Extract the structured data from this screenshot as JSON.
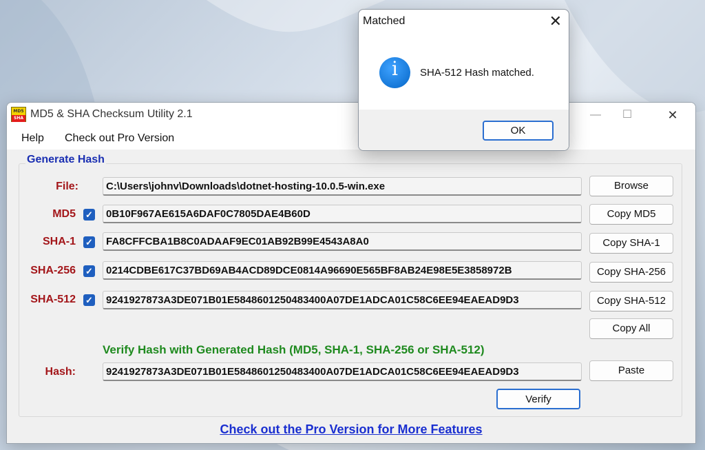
{
  "main_window": {
    "title": "MD5 & SHA Checksum Utility 2.1",
    "icon_text_top": "MD5",
    "icon_text_bottom": "SHA",
    "controls": {
      "minimize": "—",
      "maximize": "☐",
      "close": "✕"
    }
  },
  "menu": [
    "Help",
    "Check out Pro Version"
  ],
  "generate": {
    "title": "Generate Hash",
    "file": {
      "label": "File:",
      "value": "C:\\Users\\johnv\\Downloads\\dotnet-hosting-10.0.5-win.exe",
      "button": "Browse"
    },
    "rows": [
      {
        "label": "MD5",
        "checked": true,
        "value": "0B10F967AE615A6DAF0C7805DAE4B60D",
        "button": "Copy MD5"
      },
      {
        "label": "SHA-1",
        "checked": true,
        "value": "FA8CFFCBA1B8C0ADAAF9EC01AB92B99E4543A8A0",
        "button": "Copy SHA-1"
      },
      {
        "label": "SHA-256",
        "checked": true,
        "value": "0214CDBE617C37BD69AB4ACD89DCE0814A96690E565BF8AB24E98E5E3858972B",
        "button": "Copy SHA-256"
      },
      {
        "label": "SHA-512",
        "checked": true,
        "value": "9241927873A3DE071B01E5848601250483400A07DE1ADCA01C58C6EE94EAEAD9D3",
        "button": "Copy SHA-512"
      }
    ],
    "copy_all": "Copy All"
  },
  "verify": {
    "title": "Verify Hash with Generated Hash (MD5, SHA-1, SHA-256 or SHA-512)",
    "hash_label": "Hash:",
    "hash_value": "9241927873A3DE071B01E5848601250483400A07DE1ADCA01C58C6EE94EAEAD9D3",
    "paste": "Paste",
    "verify": "Verify"
  },
  "pro_link": "Check out the Pro Version for More Features",
  "dialog": {
    "title": "Matched",
    "close": "✕",
    "icon_glyph": "i",
    "icon": "info-icon",
    "message": "SHA-512 Hash matched.",
    "ok": "OK"
  },
  "colors": {
    "label_red": "#a3161a",
    "group_title_blue": "#1a2fb2",
    "verify_green": "#1f8a1f",
    "link_blue": "#1a2fd0",
    "checkbox_blue": "#1f5fbf"
  }
}
